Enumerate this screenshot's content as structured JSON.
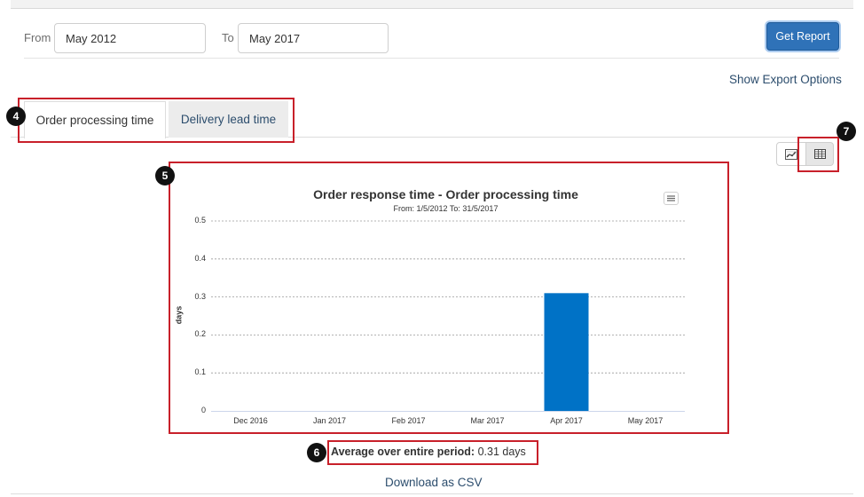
{
  "filters": {
    "from_label": "From",
    "from_value": "May 2012",
    "to_label": "To",
    "to_value": "May 2017",
    "submit_label": "Get Report"
  },
  "export_link": "Show Export Options",
  "tabs": [
    {
      "label": "Order processing time",
      "active": true
    },
    {
      "label": "Delivery lead time",
      "active": false
    }
  ],
  "annotations": [
    "4",
    "5",
    "6",
    "7"
  ],
  "view_toggle": {
    "chart_icon": "line-chart-icon",
    "table_icon": "table-icon",
    "active": "table"
  },
  "chart_menu_icon": "hamburger-menu-icon",
  "chart_data": {
    "type": "bar",
    "title": "Order response time - Order processing time",
    "subtitle": "From: 1/5/2012 To: 31/5/2017",
    "xlabel": "",
    "ylabel": "days",
    "categories": [
      "Dec 2016",
      "Jan 2017",
      "Feb 2017",
      "Mar 2017",
      "Apr 2017",
      "May 2017"
    ],
    "values": [
      0,
      0,
      0,
      0,
      0.31,
      0
    ],
    "ylim": [
      0,
      0.5
    ],
    "yticks": [
      "0",
      "0.1",
      "0.2",
      "0.3",
      "0.4",
      "0.5"
    ],
    "grid": true,
    "bar_color": "#0072c6"
  },
  "summary": {
    "label": "Average over entire period:",
    "value": "0.31 days"
  },
  "download_link": "Download as CSV",
  "colors": {
    "annotation_box": "#c8202a",
    "primary_button": "#2f72b8",
    "link": "#2c4d6d"
  }
}
